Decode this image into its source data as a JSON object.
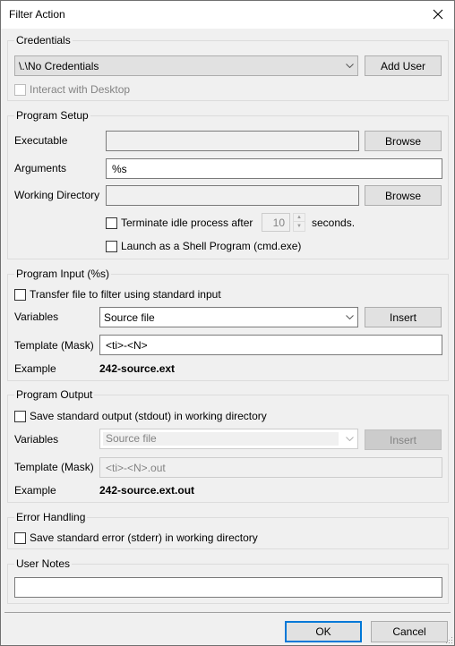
{
  "window": {
    "title": "Filter Action",
    "close_label": "×"
  },
  "credentials": {
    "legend": "Credentials",
    "user_select": "\\.\\No Credentials",
    "add_user_label": "Add User",
    "interact_desktop_label": "Interact with Desktop",
    "interact_desktop_checked": false,
    "interact_desktop_enabled": false
  },
  "program_setup": {
    "legend": "Program Setup",
    "executable_label": "Executable",
    "executable_value": "",
    "browse_executable_label": "Browse",
    "arguments_label": "Arguments",
    "arguments_value": "%s",
    "working_dir_label": "Working Directory",
    "working_dir_value": "",
    "browse_working_dir_label": "Browse",
    "terminate_idle_label": "Terminate idle process after",
    "terminate_idle_checked": false,
    "idle_seconds_value": "10",
    "seconds_label": "seconds.",
    "shell_program_label": "Launch as a Shell Program (cmd.exe)",
    "shell_program_checked": false
  },
  "program_input": {
    "legend": "Program Input (%s)",
    "transfer_stdin_label": "Transfer file to filter using standard input",
    "transfer_stdin_checked": false,
    "variables_label": "Variables",
    "variables_value": "Source file",
    "insert_label": "Insert",
    "template_label": "Template (Mask)",
    "template_value": "<ti>-<N>",
    "example_label": "Example",
    "example_value": "242-source.ext"
  },
  "program_output": {
    "legend": "Program Output",
    "save_stdout_label": "Save standard output (stdout) in working directory",
    "save_stdout_checked": false,
    "variables_label": "Variables",
    "variables_value": "Source file",
    "insert_label": "Insert",
    "template_label": "Template (Mask)",
    "template_value": "<ti>-<N>.out",
    "example_label": "Example",
    "example_value": "242-source.ext.out"
  },
  "error_handling": {
    "legend": "Error Handling",
    "save_stderr_label": "Save standard error (stderr) in working directory",
    "save_stderr_checked": false
  },
  "user_notes": {
    "legend": "User Notes",
    "value": ""
  },
  "footer": {
    "ok_label": "OK",
    "cancel_label": "Cancel"
  },
  "colors": {
    "accent": "#0078d7",
    "dialog_bg": "#f0f0f0",
    "disabled_text": "#838383"
  }
}
